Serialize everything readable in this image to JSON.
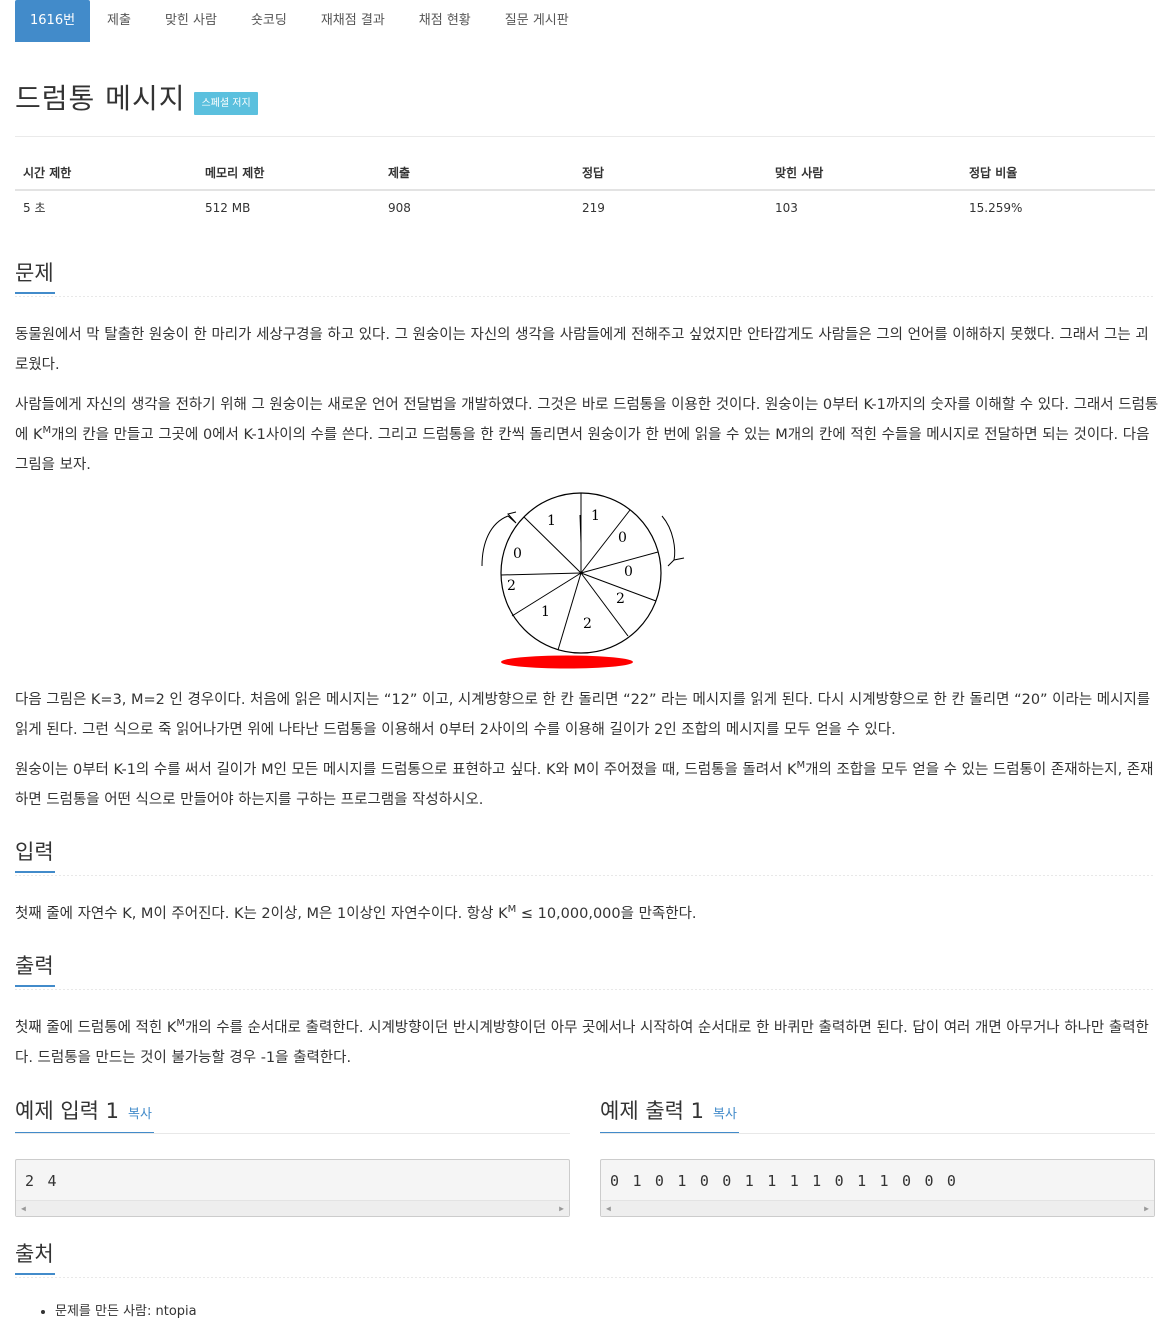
{
  "tabs": {
    "problem": "1616번",
    "submit": "제출",
    "solvers": "맞힌 사람",
    "shortcoding": "숏코딩",
    "rejudge": "재채점 결과",
    "status": "채점 현황",
    "board": "질문 게시판"
  },
  "problem": {
    "title": "드럼통 메시지",
    "special_label": "스페셜 저지"
  },
  "stats": {
    "headers": [
      "시간 제한",
      "메모리 제한",
      "제출",
      "정답",
      "맞힌 사람",
      "정답 비율"
    ],
    "values": [
      "5 초",
      "512 MB",
      "908",
      "219",
      "103",
      "15.259%"
    ]
  },
  "sections": {
    "description": "문제",
    "input": "입력",
    "output": "출력",
    "source": "출처"
  },
  "description": {
    "p1": "동물원에서 막 탈출한 원숭이 한 마리가 세상구경을 하고 있다. 그 원숭이는 자신의 생각을 사람들에게 전해주고 싶었지만 안타깝게도 사람들은 그의 언어를 이해하지 못했다. 그래서 그는 괴로웠다.",
    "p2a": "사람들에게 자신의 생각을 전하기 위해 그 원숭이는 새로운 언어 전달법을 개발하였다. 그것은 바로 드럼통을 이용한 것이다. 원숭이는 0부터 K-1까지의 숫자를 이해할 수 있다. 그래서 드럼통에 K",
    "p2_sup": "M",
    "p2b": "개의 칸을 만들고 그곳에 0에서 K-1사이의 수를 쓴다. 그리고 드럼통을 한 칸씩 돌리면서 원숭이가 한 번에 읽을 수 있는 M개의 칸에 적힌 수들을 메시지로 전달하면 되는 것이다. 다음 그림을 보자.",
    "p3": "다음 그림은 K=3, M=2 인 경우이다. 처음에 읽은 메시지는 “12” 이고, 시계방향으로 한 칸 돌리면 “22” 라는 메시지를 읽게 된다. 다시 시계방향으로 한 칸 돌리면 “20” 이라는 메시지를 읽게 된다. 그런 식으로 죽 읽어나가면 위에 나타난 드럼통을 이용해서 0부터 2사이의 수를 이용해 길이가 2인 조합의 메시지를 모두 얻을 수 있다.",
    "p4a": "원숭이는 0부터 K-1의 수를 써서 길이가 M인 모든 메시지를 드럼통으로 표현하고 싶다. K와 M이 주어졌을 때, 드럼통을 돌려서 K",
    "p4_sup": "M",
    "p4b": "개의 조합을 모두 얻을 수 있는 드럼통이 존재하는지, 존재하면 드럼통을 어떤 식으로 만들어야 하는지를 구하는 프로그램을 작성하시오."
  },
  "figure": {
    "digits": [
      "1",
      "1",
      "0",
      "0",
      "2",
      "2",
      "1",
      "2",
      "0"
    ]
  },
  "input": {
    "a": "첫째 줄에 자연수 K, M이 주어진다. K는 2이상, M은 1이상인 자연수이다. 항상 K",
    "sup": "M",
    "b": " ≤ 10,000,000을 만족한다."
  },
  "output": {
    "a": "첫째 줄에 드럼통에 적힌 K",
    "sup": "M",
    "b": "개의 수를 순서대로 출력한다. 시계방향이던 반시계방향이던 아무 곳에서나 시작하여 순서대로 한 바퀴만 출력하면 된다. 답이 여러 개면 아무거나 하나만 출력한다. 드럼통을 만드는 것이 불가능할 경우 -1을 출력한다."
  },
  "samples": {
    "input_title": "예제 입력 1",
    "output_title": "예제 출력 1",
    "copy": "복사",
    "input_text": "2 4",
    "output_text": "0 1 0 1 0 0 1 1 1 1 0 1 1 0 0 0"
  },
  "source": {
    "item": "문제를 만든 사람: ntopia"
  },
  "colors": {
    "accent": "#428bca",
    "label": "#5bc0de",
    "drum_base": "#ff0000"
  }
}
